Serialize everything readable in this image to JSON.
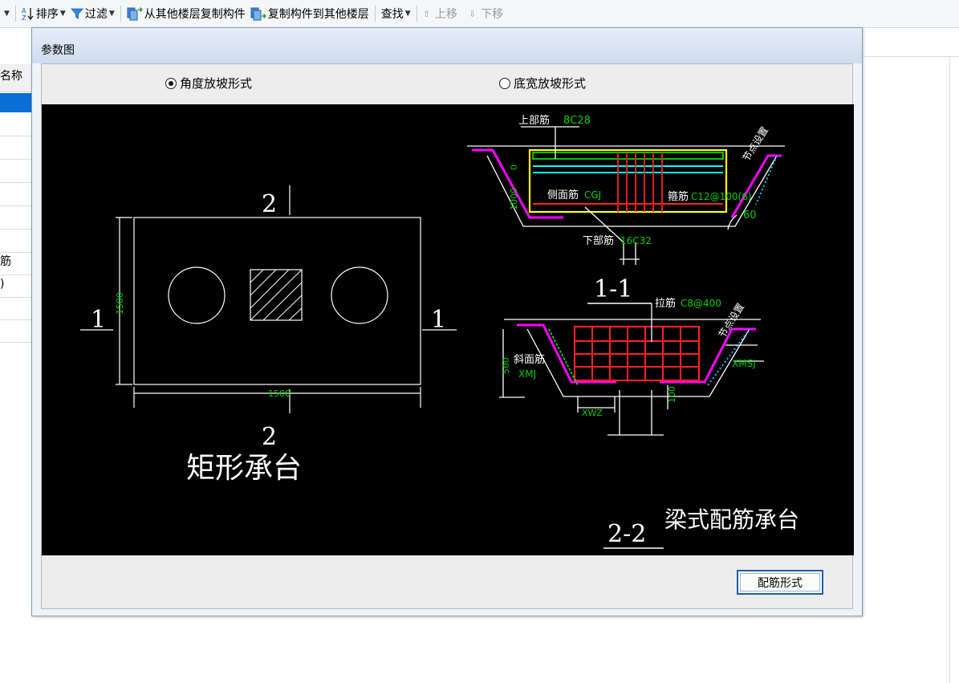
{
  "toolbar": {
    "sort_label": "排序",
    "filter_label": "过滤",
    "copy_from_floor_label": "从其他楼层复制构件",
    "copy_to_floor_label": "复制构件到其他楼层",
    "find_label": "查找",
    "move_up_label": "上移",
    "move_down_label": "下移"
  },
  "left_pane": {
    "header": "名称",
    "rows": [
      "",
      "",
      "",
      "",
      "",
      "",
      "筋",
      ")",
      "",
      ""
    ]
  },
  "dialog": {
    "title": "参数图",
    "radio_options": [
      {
        "label": "角度放坡形式",
        "selected": true
      },
      {
        "label": "底宽放坡形式",
        "selected": false
      }
    ],
    "button_label": "配筋形式"
  },
  "drawing": {
    "plan": {
      "section_mark_2": "2",
      "section_mark_1": "1",
      "height_dim": "1500",
      "width_dim": "1500",
      "caption": "矩形承台"
    },
    "section_11": {
      "top_bar_label": "上部筋",
      "top_bar_value": "8C28",
      "side_bar_label": "侧面筋",
      "side_bar_value": "CGJ",
      "stirrup_label": "箍筋",
      "stirrup_value": "C12@100(6)",
      "bottom_bar_label": "下部筋",
      "bottom_bar_value": "16C32",
      "angle": "60",
      "height_dims": [
        "0",
        "1000"
      ],
      "slope_note": "节点设置",
      "title": "1-1"
    },
    "section_22": {
      "tie_bar_label": "拉筋",
      "tie_bar_value": "C8@400",
      "slant_bar_label": "斜面筋",
      "slant_bar_code": "XMJ",
      "right_code": "XMSJ",
      "bottom_code": "XWZ",
      "height_dim": "500",
      "inner_dim": "100",
      "slope_note": "节点设置",
      "title": "2-2",
      "caption": "梁式配筋承台"
    }
  },
  "colors": {
    "canvas_bg": "#000000",
    "line_white": "#ffffff",
    "dim_green": "#00d000",
    "rebar_red": "#ff2020",
    "rebar_yellow": "#ffff00",
    "rebar_cyan": "#00ffff",
    "outline_magenta": "#ff00ff",
    "rebar_green": "#00ff00",
    "dialog_bg": "#eef3f9",
    "button_border": "#1a5fb0"
  }
}
